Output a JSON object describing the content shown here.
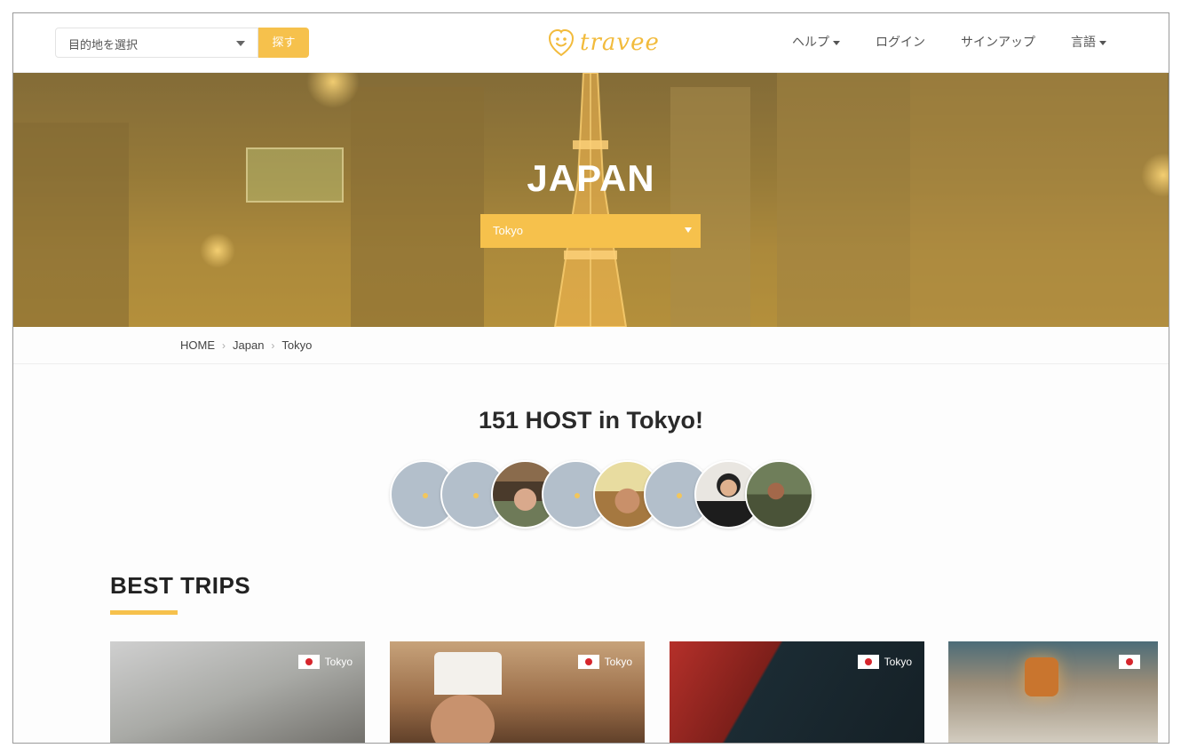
{
  "header": {
    "destination_placeholder": "目的地を選択",
    "search_label": "探す",
    "logo_text": "travee",
    "nav": [
      {
        "label": "ヘルプ",
        "dropdown": true
      },
      {
        "label": "ログイン",
        "dropdown": false
      },
      {
        "label": "サインアップ",
        "dropdown": false
      },
      {
        "label": "言語",
        "dropdown": true
      }
    ]
  },
  "hero": {
    "country": "JAPAN",
    "city_selected": "Tokyo"
  },
  "breadcrumb": [
    "HOME",
    "Japan",
    "Tokyo"
  ],
  "hosts": {
    "title": "151 HOST in Tokyo!"
  },
  "best_trips": {
    "title": "BEST TRIPS",
    "cards": [
      {
        "location": "Tokyo"
      },
      {
        "location": "Tokyo"
      },
      {
        "location": "Tokyo"
      },
      {
        "location": ""
      }
    ]
  },
  "colors": {
    "accent": "#f6c14c",
    "avatar_placeholder": "#b3bfcb"
  },
  "icons": {
    "logo": "travee-smile-icon",
    "flag": "japan-flag-icon"
  }
}
